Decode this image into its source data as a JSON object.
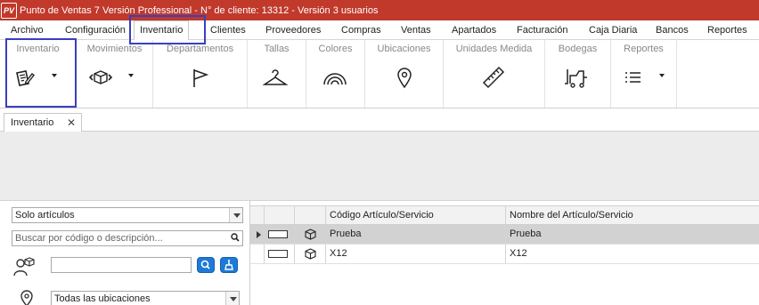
{
  "window": {
    "logo_text": "PV",
    "title": "Punto de Ventas 7 Versión  Professional  - N° de cliente: 13312 - Versión 3 usuarios"
  },
  "menu": {
    "items": [
      "Archivo",
      "Configuración",
      "Inventario",
      "Clientes",
      "Proveedores",
      "Compras",
      "Ventas",
      "Apartados",
      "Facturación",
      "Caja Diaria",
      "Bancos",
      "Reportes"
    ],
    "active": "Inventario"
  },
  "ribbon": {
    "groups": [
      {
        "label": "Inventario",
        "icon": "edit-document-icon",
        "dropdown": true
      },
      {
        "label": "Movimientos",
        "icon": "box-transfer-icon",
        "dropdown": true
      },
      {
        "label": "Departamentos",
        "icon": "flag-icon",
        "dropdown": false
      },
      {
        "label": "Tallas",
        "icon": "hanger-icon",
        "dropdown": false
      },
      {
        "label": "Colores",
        "icon": "rainbow-icon",
        "dropdown": false
      },
      {
        "label": "Ubicaciones",
        "icon": "map-pin-icon",
        "dropdown": false
      },
      {
        "label": "Unidades Medida",
        "icon": "ruler-icon",
        "dropdown": false
      },
      {
        "label": "Bodegas",
        "icon": "forklift-icon",
        "dropdown": false
      },
      {
        "label": "Reportes",
        "icon": "list-icon",
        "dropdown": true
      }
    ]
  },
  "doc_tab": {
    "label": "Inventario",
    "close": "✕"
  },
  "filters": {
    "type_select": "Solo artículos",
    "search_placeholder": "Buscar por código o descripción...",
    "location_select": "Todas las ubicaciones"
  },
  "grid": {
    "columns": [
      "",
      "",
      "Código Artículo/Servicio",
      "Nombre del Artículo/Servicio"
    ],
    "rows": [
      {
        "code": "Prueba",
        "name": "Prueba",
        "selected": true
      },
      {
        "code": "X12",
        "name": "X12",
        "selected": false
      }
    ]
  }
}
